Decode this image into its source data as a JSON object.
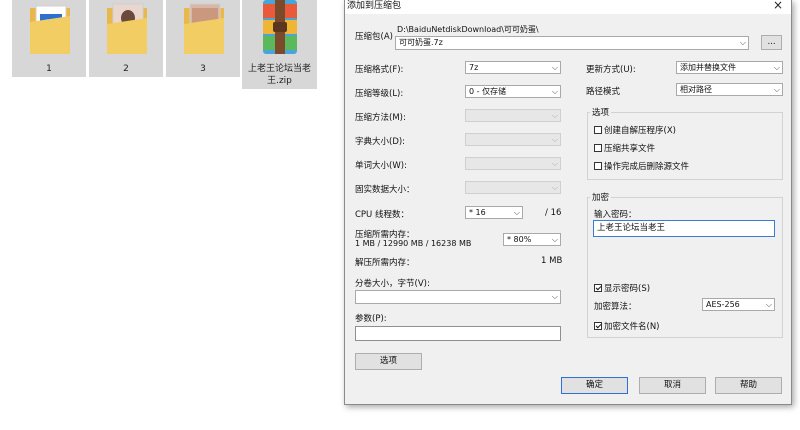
{
  "desktop": {
    "folders": [
      {
        "name": "1"
      },
      {
        "name": "2"
      },
      {
        "name": "3"
      }
    ],
    "zip": {
      "name_line1": "上老王论坛当老",
      "name_line2": "王.zip"
    }
  },
  "dialog": {
    "title": "添加到压缩包",
    "close_icon": "×",
    "archive": {
      "label": "压缩包(A)",
      "path": "D:\\BaiduNetdiskDownload\\可可奶蛋\\",
      "value": "可可奶蛋.7z",
      "browse_label": "..."
    },
    "left": {
      "format_label": "压缩格式(F):",
      "format_value": "7z",
      "level_label": "压缩等级(L):",
      "level_value": "0 - 仅存储",
      "method_label": "压缩方法(M):",
      "dict_label": "字典大小(D):",
      "word_label": "单词大小(W):",
      "solid_label": "固实数据大小：",
      "cpu_label": "CPU 线程数：",
      "cpu_value": "* 16",
      "cpu_total": "/ 16",
      "mem_label": "压缩所需内存：",
      "mem_detail": "1 MB / 12990 MB / 16238 MB",
      "mem_percent": "* 80%",
      "decomp_label": "解压所需内存：",
      "decomp_value": "1 MB",
      "split_label": "分卷大小，字节(V):",
      "params_label": "参数(P):",
      "options_button": "选项"
    },
    "right": {
      "update_label": "更新方式(U):",
      "update_value": "添加并替换文件",
      "pathmode_label": "路径模式",
      "pathmode_value": "相对路径",
      "options_group": "选项",
      "opt_sfx": "创建自解压程序(X)",
      "opt_shared": "压缩共享文件",
      "opt_delete": "操作完成后删除源文件",
      "encrypt_group": "加密",
      "password_label": "输入密码：",
      "password_value": "上老王论坛当老王",
      "show_password": "显示密码(S)",
      "enc_method_label": "加密算法：",
      "enc_method_value": "AES-256",
      "encrypt_names": "加密文件名(N)"
    },
    "buttons": {
      "ok": "确定",
      "cancel": "取消",
      "help": "帮助"
    }
  }
}
